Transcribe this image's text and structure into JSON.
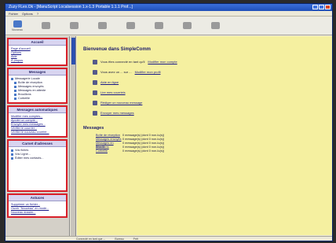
{
  "window": {
    "title": "Zuzy FLex.Ok - [ManuScript Localsession 1.x-1.3 Portable 1.1.1 Prof...]"
  },
  "menubar": [
    "Fichier",
    "Options",
    "?"
  ],
  "toolbar": [
    {
      "label": "Nouveau",
      "icon": "new-mail-icon"
    },
    {
      "label": "",
      "icon": "reply-icon"
    },
    {
      "label": "",
      "icon": "reply-all-icon"
    },
    {
      "label": "",
      "icon": "forward-icon"
    },
    {
      "label": "",
      "icon": "undo-icon"
    },
    {
      "label": "",
      "icon": "print-icon"
    },
    {
      "label": "",
      "icon": "delete-icon"
    },
    {
      "label": "",
      "icon": "address-book-icon"
    }
  ],
  "sidebar": {
    "accueil": {
      "title": "Accueil",
      "links": [
        "Page d'accueil",
        "Options",
        "Aide",
        "À propos"
      ]
    },
    "messages": {
      "title": "Messages",
      "items": [
        "Messagerie Locale",
        "Boîte de réception",
        "Messages envoyés",
        "Messages en attente",
        "Brouillons",
        "Corbeille"
      ]
    },
    "comptes": {
      "title": "Messages automatiques",
      "links": [
        "Modifier mes comptes...",
        "Ajouter un compte...",
        "Envoyer mes messages...",
        "Vérifier le courrier...",
        "Vérifier le nouveau courrier..."
      ]
    },
    "carnet": {
      "title": "Carnet d'adresses",
      "items": [
        "Vos fiches",
        "Vos Ligne...",
        "Éditer mes contacts..."
      ]
    },
    "astuces": {
      "title": "Astuces",
      "links": [
        "Supprimer un fichier...",
        "Ouvrir \"Nouveau\" en mode...",
        "Nouveau dossier..."
      ]
    }
  },
  "main": {
    "heading": "Bienvenue dans SimpleComm",
    "rows": [
      {
        "text": "Vous êtes connecté en tant qu'il",
        "link": "Modifier mon compte"
      },
      {
        "text": "Vous avez un ... sur ... ",
        "link": "Modifier mon profil"
      },
      {
        "text": "",
        "link": "Aide en ligne"
      },
      {
        "text": "",
        "link": "Lire mes courriels"
      },
      {
        "text": "",
        "link": "Rédiger un nouveau message"
      },
      {
        "text": "",
        "link": "Envoyer mes messages"
      }
    ],
    "messages_title": "Messages",
    "messages_rows": [
      {
        "folder": "Boîte de réception",
        "info": "0 message(s) (dont 0 non-lu(s))"
      },
      {
        "folder": "Messages envoyés",
        "info": "0 message(s) (dont 0 non-lu(s))"
      },
      {
        "folder": "Messages en attente",
        "info": "0 message(s) (dont 0 non-lu(s))"
      },
      {
        "folder": "Brouillons",
        "info": "0 message(s) (dont 0 non-lu(s))"
      },
      {
        "folder": "Corbeille",
        "info": "0 message(s) (dont 0 non-lu(s))"
      }
    ]
  },
  "statusbar": {
    "left": "Connecté en tant que ...",
    "middle": "Bureau",
    "right": "Prêt"
  }
}
